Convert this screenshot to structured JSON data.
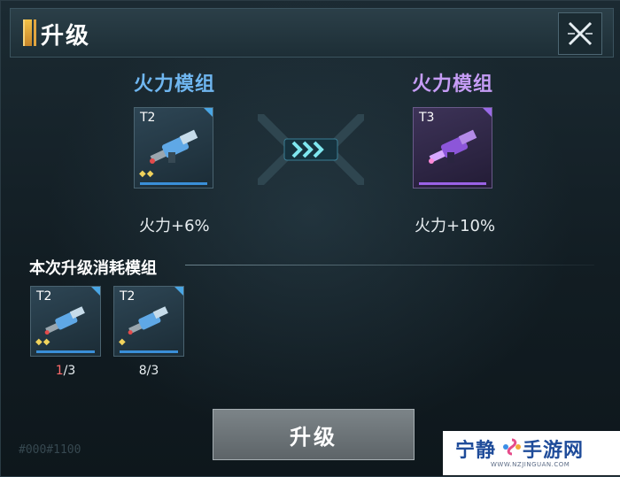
{
  "header": {
    "title": "升级"
  },
  "current": {
    "name": "火力模组",
    "tier": "T2",
    "stat": "火力+6%",
    "stars": "◆◆"
  },
  "next": {
    "name": "火力模组",
    "tier": "T3",
    "stat": "火力+10%"
  },
  "cost": {
    "title": "本次升级消耗模组",
    "items": [
      {
        "tier": "T2",
        "stars": "◆◆",
        "count_have": "1",
        "count_sep": "/3"
      },
      {
        "tier": "T2",
        "stars": "◆",
        "count_have": "8",
        "count_sep": "/3"
      }
    ]
  },
  "upgrade_button": "升级",
  "footer_id": "#000#1100",
  "watermark": {
    "text_a": "宁静",
    "text_b": "手游网",
    "url": "WWW.NZJINGUAN.COM"
  },
  "colors": {
    "t2": "#3a8fd8",
    "t3": "#9a62e6",
    "accent": "#f4c247"
  }
}
